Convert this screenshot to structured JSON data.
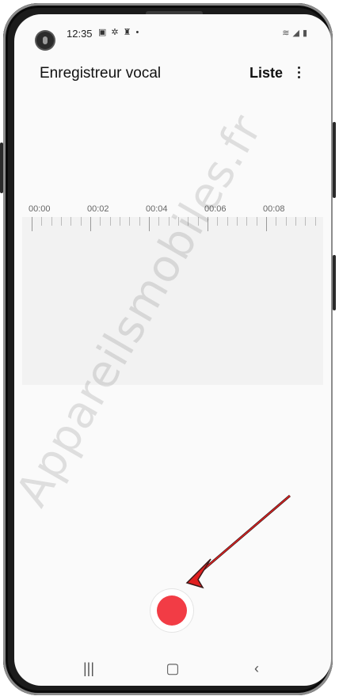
{
  "status_bar": {
    "time": "12:35",
    "left_icons": [
      "gallery-icon",
      "gear-icon",
      "bluetooth-icon",
      "dot-icon"
    ],
    "right_icons": [
      "wifi-icon",
      "signal-icon",
      "battery-icon"
    ]
  },
  "app_bar": {
    "title": "Enregistreur vocal",
    "list_label": "Liste"
  },
  "timeline": {
    "labels": [
      "00:00",
      "00:02",
      "00:04",
      "00:06",
      "00:08"
    ]
  },
  "watermark": {
    "text": "Appareilsmobiles.fr"
  },
  "nav": {
    "recent": "|||",
    "home": "▢",
    "back": "‹"
  },
  "colors": {
    "record": "#f23c45",
    "arrow": "#e02020"
  }
}
